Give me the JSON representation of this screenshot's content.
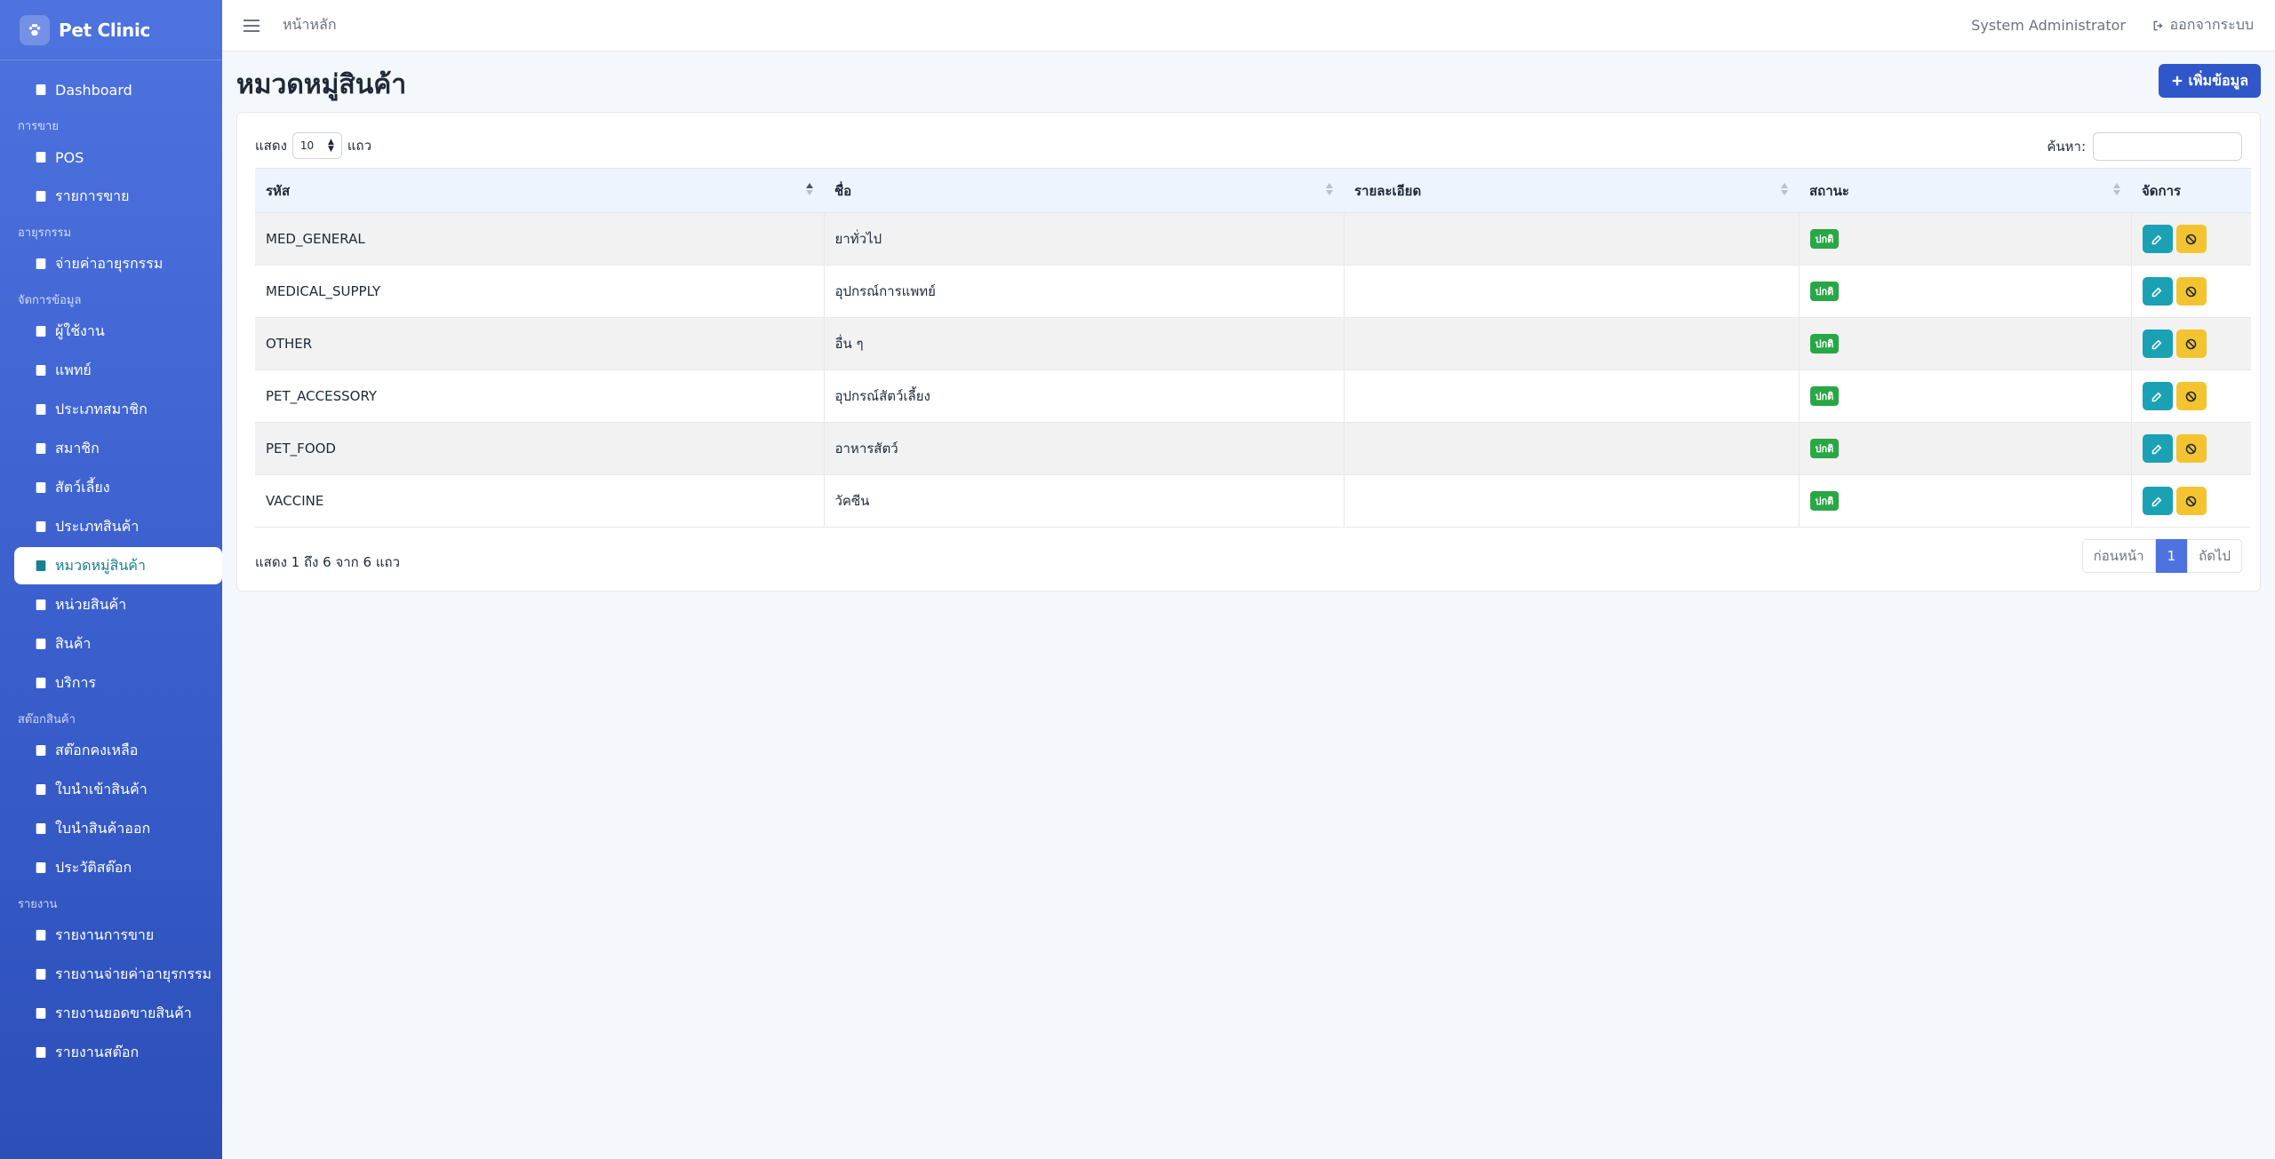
{
  "brand": {
    "name": "Pet Clinic"
  },
  "sidebar": {
    "dashboard": "Dashboard",
    "sections": [
      {
        "title": "การขาย",
        "items": [
          "POS",
          "รายการขาย"
        ]
      },
      {
        "title": "อายุรกรรม",
        "items": [
          "จ่ายค่าอายุรกรรม"
        ]
      },
      {
        "title": "จัดการข้อมูล",
        "items": [
          "ผู้ใช้งาน",
          "แพทย์",
          "ประเภทสมาชิก",
          "สมาชิก",
          "สัตว์เลี้ยง",
          "ประเภทสินค้า",
          "หมวดหมู่สินค้า",
          "หน่วยสินค้า",
          "สินค้า",
          "บริการ"
        ]
      },
      {
        "title": "สต๊อกสินค้า",
        "items": [
          "สต๊อกคงเหลือ",
          "ใบนำเข้าสินค้า",
          "ใบนำสินค้าออก",
          "ประวัติสต๊อก"
        ]
      },
      {
        "title": "รายงาน",
        "items": [
          "รายงานการขาย",
          "รายงานจ่ายค่าอายุรกรรม",
          "รายงานยอดขายสินค้า",
          "รายงานสต๊อก"
        ]
      }
    ],
    "active": "หมวดหมู่สินค้า"
  },
  "topbar": {
    "breadcrumb": "หน้าหลัก",
    "user": "System Administrator",
    "logout": "ออกจากระบบ"
  },
  "page": {
    "title": "หมวดหมู่สินค้า",
    "add_label": "เพิ่มข้อมูล"
  },
  "table_controls": {
    "show_prefix": "แสดง",
    "show_value": "10",
    "show_suffix": "แถว",
    "search_label": "ค้นหา:"
  },
  "table": {
    "headers": [
      "รหัส",
      "ชื่อ",
      "รายละเอียด",
      "สถานะ",
      "จัดการ"
    ],
    "rows": [
      {
        "code": "MED_GENERAL",
        "name": "ยาทั่วไป",
        "detail": "",
        "status": "ปกติ"
      },
      {
        "code": "MEDICAL_SUPPLY",
        "name": "อุปกรณ์การแพทย์",
        "detail": "",
        "status": "ปกติ"
      },
      {
        "code": "OTHER",
        "name": "อื่น ๆ",
        "detail": "",
        "status": "ปกติ"
      },
      {
        "code": "PET_ACCESSORY",
        "name": "อุปกรณ์สัตว์เลี้ยง",
        "detail": "",
        "status": "ปกติ"
      },
      {
        "code": "PET_FOOD",
        "name": "อาหารสัตว์",
        "detail": "",
        "status": "ปกติ"
      },
      {
        "code": "VACCINE",
        "name": "วัคซีน",
        "detail": "",
        "status": "ปกติ"
      }
    ]
  },
  "footer": {
    "info": "แสดง 1 ถึง 6 จาก 6 แถว",
    "prev": "ก่อนหน้า",
    "page": "1",
    "next": "ถัดไป"
  },
  "colors": {
    "sidebar": "#4e73df",
    "primary": "#2f57c9",
    "edit": "#1aa1b4",
    "ban": "#f4c430",
    "badge": "#28a745"
  }
}
